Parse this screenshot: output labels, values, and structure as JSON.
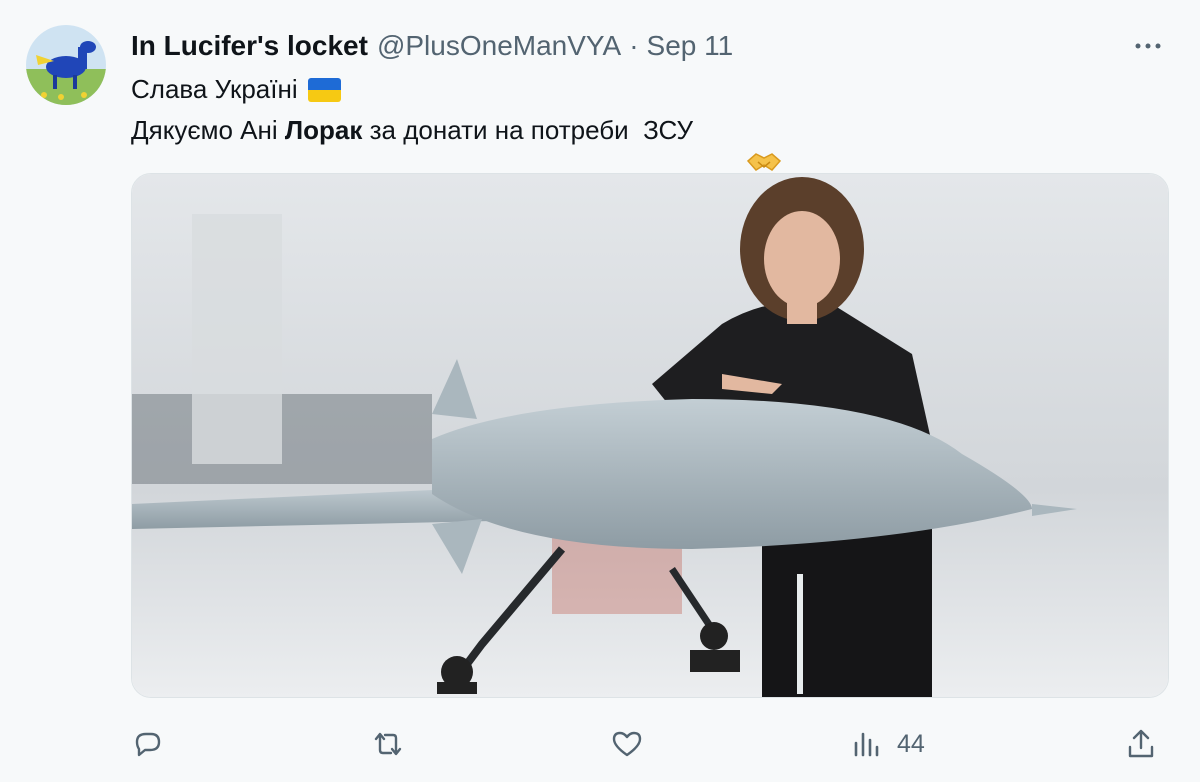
{
  "tweet": {
    "display_name": "In Lucifer's locket",
    "handle": "@PlusOneManVYA",
    "separator": "·",
    "date": "Sep 11",
    "line1": "Слава Україні",
    "line2_before": "Дякуємо Ані ",
    "line2_bold": "Лорак",
    "line2_after": " за донати на потреби  ЗСУ",
    "flag_emoji": "ukraine-flag",
    "handshake_emoji": "handshake-emoji"
  },
  "actions": {
    "views_count": "44"
  },
  "colors": {
    "text": "#0f1419",
    "muted": "#536471",
    "background": "#f7f9fa"
  }
}
